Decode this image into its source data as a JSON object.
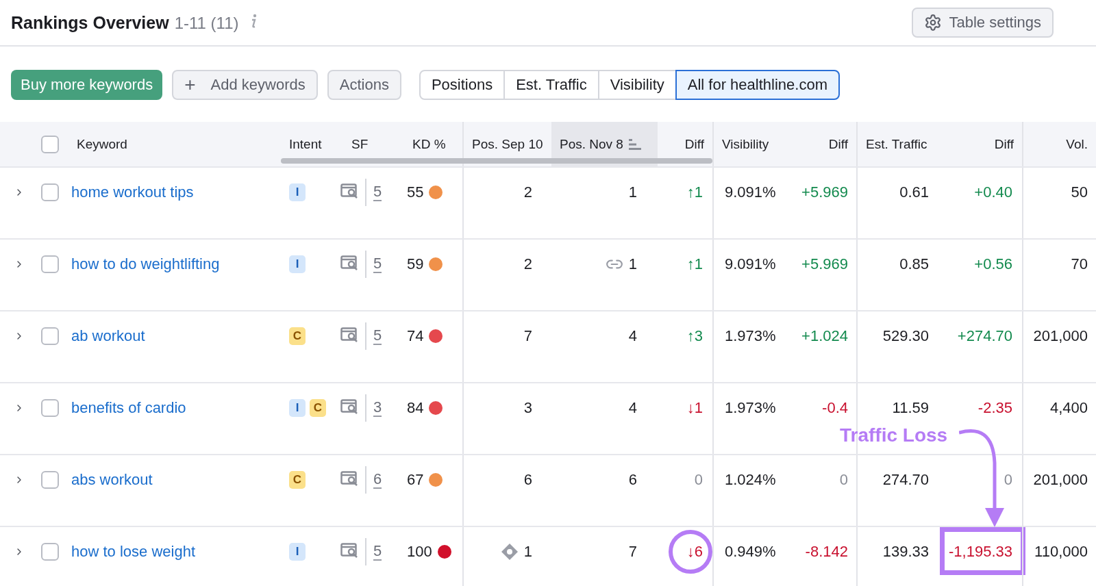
{
  "header": {
    "title": "Rankings Overview",
    "range": "1-11 (11)",
    "settings_button": "Table settings"
  },
  "toolbar": {
    "buy_button": "Buy more keywords",
    "add_button": {
      "icon": "+",
      "label": "Add keywords"
    },
    "actions_button": "Actions"
  },
  "tabs": [
    {
      "label": "Positions",
      "selected": false
    },
    {
      "label": "Est. Traffic",
      "selected": false
    },
    {
      "label": "Visibility",
      "selected": false
    },
    {
      "label": "All for healthline.com",
      "selected": true
    }
  ],
  "table": {
    "select_all_checked": false,
    "columns": [
      {
        "label": "Keyword",
        "sorted": false
      },
      {
        "label": "Intent",
        "sorted": false
      },
      {
        "label": "SF",
        "sorted": false
      },
      {
        "label": "KD %",
        "sorted": false
      },
      {
        "label": "Pos. Sep 10",
        "sorted": false
      },
      {
        "label": "Pos. Nov 8",
        "sorted": true
      },
      {
        "label": "Diff",
        "sorted": false
      },
      {
        "label": "Visibility",
        "sorted": false
      },
      {
        "label": "Diff",
        "sorted": false
      },
      {
        "label": "Est. Traffic",
        "sorted": false
      },
      {
        "label": "Diff",
        "sorted": false
      },
      {
        "label": "Vol.",
        "sorted": false
      }
    ],
    "rows": [
      {
        "expanded": false,
        "checked": false,
        "keyword": "home workout tips",
        "intents": [
          {
            "label": "I",
            "kind": "informational"
          }
        ],
        "sf": "5",
        "kd": {
          "text": "55",
          "color": "#f0914a"
        },
        "pos_sep": {
          "text": "2"
        },
        "pos_nov": {
          "text": "1"
        },
        "pos_diff": {
          "text": "↑1",
          "color": "#138a4e",
          "circled": false
        },
        "visibility": "9.091%",
        "visibility_diff": {
          "text": "+5.969",
          "color": "#138a4e"
        },
        "traffic": "0.61",
        "traffic_diff": {
          "text": "+0.40",
          "color": "#138a4e",
          "boxed": false
        },
        "volume": "50"
      },
      {
        "expanded": false,
        "checked": false,
        "keyword": "how to do weightlifting",
        "intents": [
          {
            "label": "I",
            "kind": "informational"
          }
        ],
        "sf": "5",
        "kd": {
          "text": "59",
          "color": "#f0914a"
        },
        "pos_sep": {
          "text": "2"
        },
        "pos_nov": {
          "text": "1",
          "kind": "link"
        },
        "pos_diff": {
          "text": "↑1",
          "color": "#138a4e",
          "circled": false
        },
        "visibility": "9.091%",
        "visibility_diff": {
          "text": "+5.969",
          "color": "#138a4e"
        },
        "traffic": "0.85",
        "traffic_diff": {
          "text": "+0.56",
          "color": "#138a4e",
          "boxed": false
        },
        "volume": "70"
      },
      {
        "expanded": false,
        "checked": false,
        "keyword": "ab workout",
        "intents": [
          {
            "label": "C",
            "kind": "commercial"
          }
        ],
        "sf": "5",
        "kd": {
          "text": "74",
          "color": "#e5484d"
        },
        "pos_sep": {
          "text": "7"
        },
        "pos_nov": {
          "text": "4"
        },
        "pos_diff": {
          "text": "↑3",
          "color": "#138a4e",
          "circled": false
        },
        "visibility": "1.973%",
        "visibility_diff": {
          "text": "+1.024",
          "color": "#138a4e"
        },
        "traffic": "529.30",
        "traffic_diff": {
          "text": "+274.70",
          "color": "#138a4e",
          "boxed": false
        },
        "volume": "201,000"
      },
      {
        "expanded": false,
        "checked": false,
        "keyword": "benefits of cardio",
        "intents": [
          {
            "label": "I",
            "kind": "informational"
          },
          {
            "label": "C",
            "kind": "commercial"
          }
        ],
        "sf": "3",
        "kd": {
          "text": "84",
          "color": "#e5484d"
        },
        "pos_sep": {
          "text": "3"
        },
        "pos_nov": {
          "text": "4"
        },
        "pos_diff": {
          "text": "↓1",
          "color": "#c8102e",
          "circled": false
        },
        "visibility": "1.973%",
        "visibility_diff": {
          "text": "-0.4",
          "color": "#c8102e"
        },
        "traffic": "11.59",
        "traffic_diff": {
          "text": "-2.35",
          "color": "#c8102e",
          "boxed": false
        },
        "volume": "4,400"
      },
      {
        "expanded": false,
        "checked": false,
        "keyword": "abs workout",
        "intents": [
          {
            "label": "C",
            "kind": "commercial"
          }
        ],
        "sf": "6",
        "kd": {
          "text": "67",
          "color": "#f0914a"
        },
        "pos_sep": {
          "text": "6"
        },
        "pos_nov": {
          "text": "6"
        },
        "pos_diff": {
          "text": "0",
          "color": "#8a8d96",
          "circled": false
        },
        "visibility": "1.024%",
        "visibility_diff": {
          "text": "0",
          "color": "#8a8d96"
        },
        "traffic": "274.70",
        "traffic_diff": {
          "text": "0",
          "color": "#8a8d96",
          "boxed": false
        },
        "volume": "201,000"
      },
      {
        "expanded": false,
        "checked": false,
        "keyword": "how to lose weight",
        "intents": [
          {
            "label": "I",
            "kind": "informational"
          }
        ],
        "sf": "5",
        "kd": {
          "text": "100",
          "color": "#d1102b"
        },
        "pos_sep": {
          "text": "1",
          "kind": "feature"
        },
        "pos_nov": {
          "text": "7"
        },
        "pos_diff": {
          "text": "↓6",
          "color": "#c8102e",
          "circled": true
        },
        "visibility": "0.949%",
        "visibility_diff": {
          "text": "-8.142",
          "color": "#c8102e"
        },
        "traffic": "139.33",
        "traffic_diff": {
          "text": "-1,195.33",
          "color": "#c8102e",
          "boxed": true
        },
        "volume": "110,000"
      }
    ]
  },
  "annotation": {
    "label": "Traffic Loss"
  }
}
